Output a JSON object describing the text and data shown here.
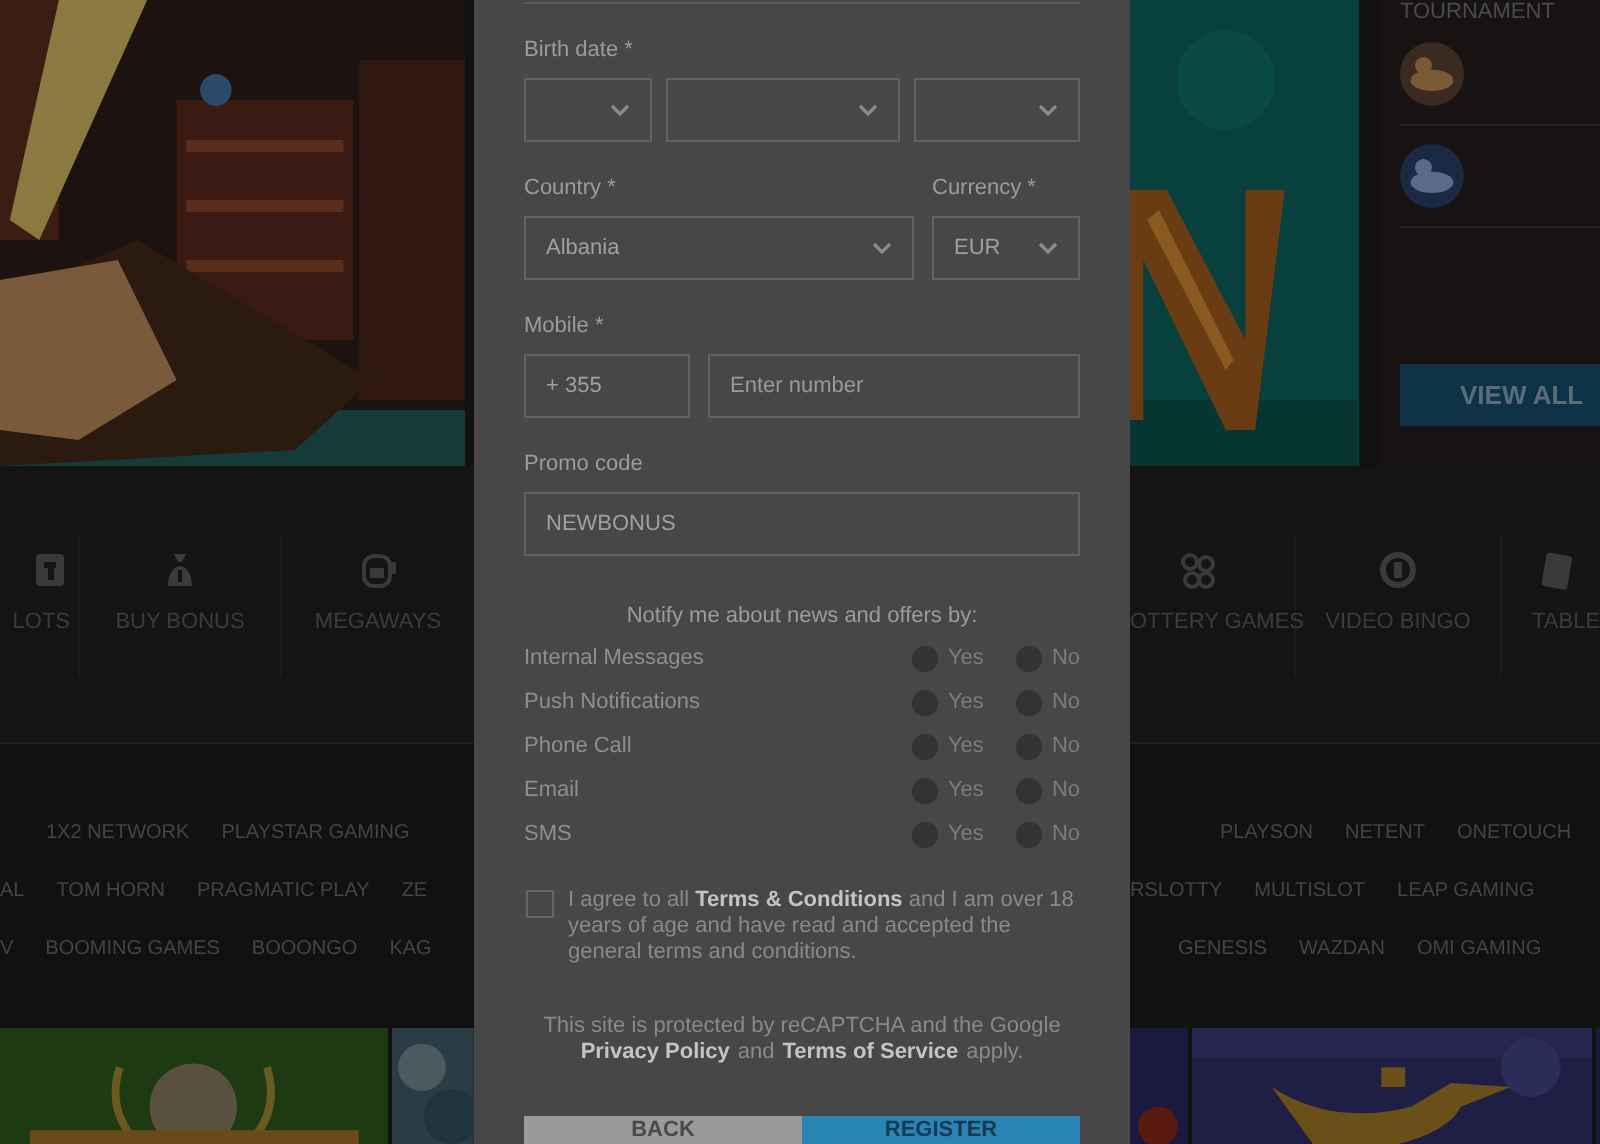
{
  "tournament": {
    "title": "TOURNAMENT",
    "button": "VIEW ALL"
  },
  "categories": {
    "left": [
      {
        "label": "LOTS"
      },
      {
        "label": "BUY BONUS"
      },
      {
        "label": "MEGAWAYS"
      }
    ],
    "right": [
      {
        "label": "OTTERY GAMES"
      },
      {
        "label": "VIDEO BINGO"
      },
      {
        "label": "TABLE"
      }
    ]
  },
  "providers": [
    {
      "left": [
        "1X2 NETWORK",
        "PLAYSTAR GAMING"
      ],
      "right": [
        "PLAYSON",
        "NETENT",
        "ONETOUCH"
      ]
    },
    {
      "left": [
        "AL",
        "TOM HORN",
        "PRAGMATIC PLAY",
        "ZE"
      ],
      "right": [
        "RSLOTTY",
        "MULTISLOT",
        "LEAP GAMING"
      ]
    },
    {
      "left": [
        "V",
        "BOOMING GAMES",
        "BOOONGO",
        "KAG"
      ],
      "right": [
        "GENESIS",
        "WAZDAN",
        "OMI GAMING"
      ]
    }
  ],
  "form": {
    "birth_date": {
      "label": "Birth date *",
      "selects": [
        {
          "kind": "dropdown"
        },
        {
          "kind": "dropdown"
        },
        {
          "kind": "dropdown"
        }
      ]
    },
    "country": {
      "label": "Country *",
      "value": "Albania"
    },
    "currency": {
      "label": "Currency *",
      "value": "EUR"
    },
    "mobile": {
      "label": "Mobile *",
      "prefix": "+ 355",
      "placeholder": "Enter number"
    },
    "promo": {
      "label": "Promo code",
      "value": "NEWBONUS"
    },
    "notify_title": "Notify me about news and offers by:",
    "notify": [
      {
        "label": "Internal Messages",
        "options": [
          {
            "label": "Yes",
            "selected": false
          },
          {
            "label": "No",
            "selected": false
          }
        ]
      },
      {
        "label": "Push Notifications",
        "options": [
          {
            "label": "Yes",
            "selected": false
          },
          {
            "label": "No",
            "selected": false
          }
        ]
      },
      {
        "label": "Phone Call",
        "options": [
          {
            "label": "Yes",
            "selected": false
          },
          {
            "label": "No",
            "selected": false
          }
        ]
      },
      {
        "label": "Email",
        "options": [
          {
            "label": "Yes",
            "selected": false
          },
          {
            "label": "No",
            "selected": false
          }
        ]
      },
      {
        "label": "SMS",
        "options": [
          {
            "label": "Yes",
            "selected": false
          },
          {
            "label": "No",
            "selected": false
          }
        ]
      }
    ],
    "agree": {
      "checked": false,
      "text": "I agree to all **Terms & Conditions** and I am over 18 years of age and have read and accepted the general terms and conditions."
    },
    "recaptcha": {
      "text": "This site is protected by reCAPTCHA and the Google",
      "privacy": "Privacy Policy",
      "and": "and",
      "terms": "Terms of Service",
      "apply": "apply."
    },
    "buttons": [
      {
        "label": "BACK",
        "kind": "secondary"
      },
      {
        "label": "REGISTER",
        "kind": "primary"
      }
    ]
  }
}
